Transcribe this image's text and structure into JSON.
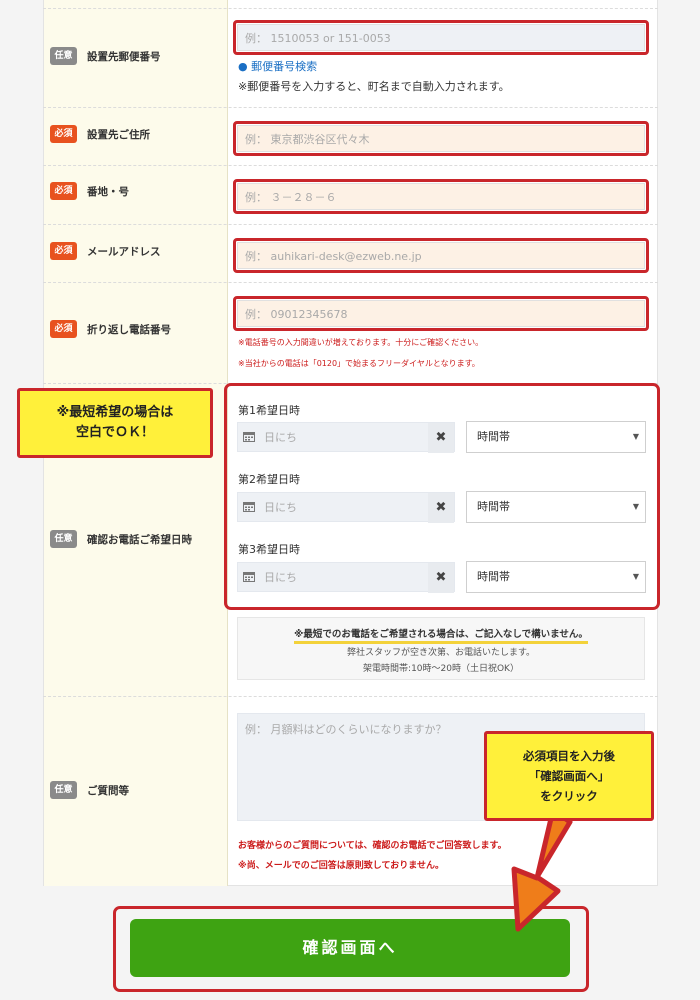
{
  "fields": {
    "postal": {
      "badge": "任意",
      "label": "設置先郵便番号",
      "placeholder": "例： 1510053 or 151-0053",
      "link": "郵便番号検索",
      "note": "※郵便番号を入力すると、町名まで自動入力されます。"
    },
    "address": {
      "badge": "必須",
      "label": "設置先ご住所",
      "placeholder": "例： 東京都渋谷区代々木"
    },
    "banchi": {
      "badge": "必須",
      "label": "番地・号",
      "placeholder": "例： ３－２８－６"
    },
    "email": {
      "badge": "必須",
      "label": "メールアドレス",
      "placeholder": "例： auhikari-desk@ezweb.ne.jp"
    },
    "phone": {
      "badge": "必須",
      "label": "折り返し電話番号",
      "placeholder": "例： 09012345678",
      "note1": "※電話番号の入力間違いが増えております。十分にご確認ください。",
      "note2": "※当社からの電話は「0120」で始まるフリーダイヤルとなります。"
    },
    "schedule": {
      "badge": "任意",
      "label": "確認お電話ご希望日時",
      "slots": [
        {
          "label": "第1希望日時",
          "date_placeholder": "日にち",
          "time": "時間帯"
        },
        {
          "label": "第2希望日時",
          "date_placeholder": "日にち",
          "time": "時間帯"
        },
        {
          "label": "第3希望日時",
          "date_placeholder": "日にち",
          "time": "時間帯"
        }
      ],
      "info": {
        "line1": "※最短でのお電話をご希望される場合は、ご記入なしで構いません。",
        "line2": "弊社スタッフが空き次第、お電話いたします。",
        "line3": "架電時間帯:10時～20時（土日祝OK）"
      }
    },
    "question": {
      "badge": "任意",
      "label": "ご質問等",
      "placeholder": "例： 月額料はどのくらいになりますか？",
      "note1": "お客様からのご質問については、確認のお電話でご回答致します。",
      "note2": "※尚、メールでのご回答は原則致しておりません。"
    }
  },
  "callouts": {
    "left_line1": "※最短希望の場合は",
    "left_line2": "空白でＯＫ！",
    "right_line1": "必須項目を入力後",
    "right_line2": "「確認画面へ」",
    "right_line3": "をクリック"
  },
  "submit_label": "確認画面へ",
  "colors": {
    "required": "#e8521f",
    "optional": "#8a8a8a",
    "button": "#3ea312",
    "highlight": "#c9262b",
    "callout": "#fff03a"
  }
}
